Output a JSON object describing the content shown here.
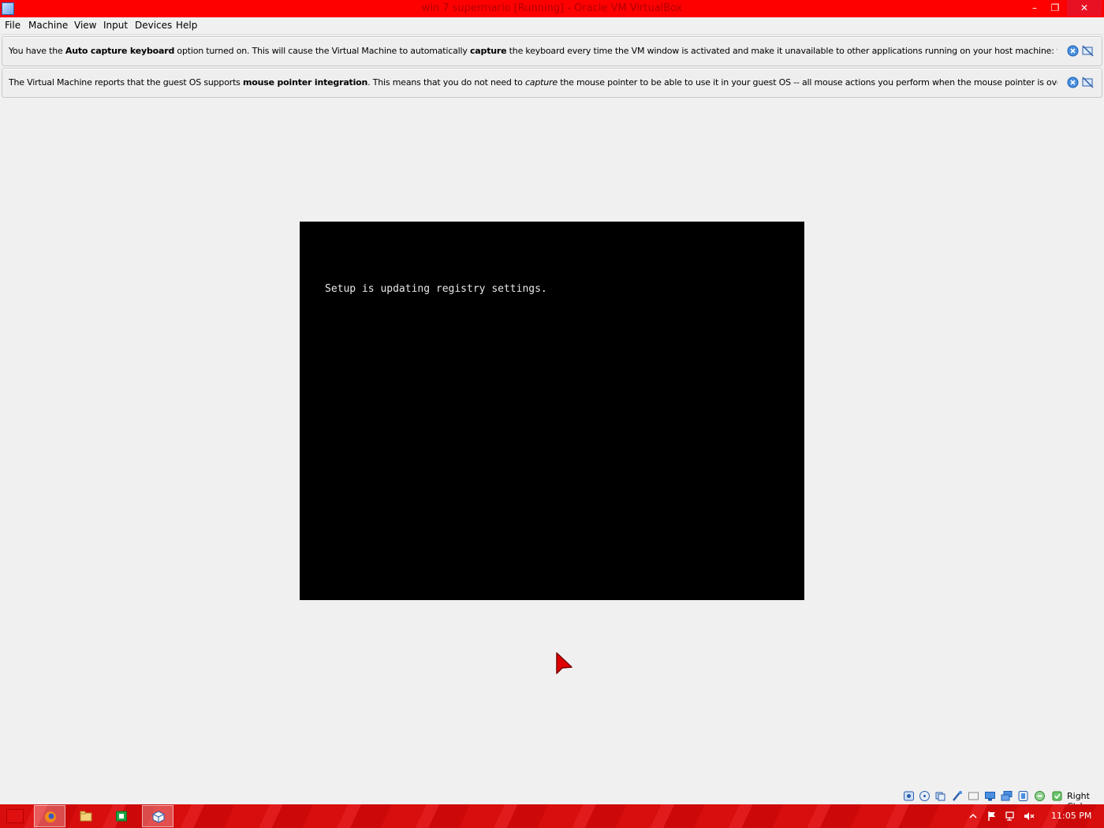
{
  "window": {
    "title": "win 7 supermario [Running] - Oracle VM VirtualBox",
    "minimize_label": "–",
    "restore_label": "❐",
    "close_label": "✕"
  },
  "menu": {
    "file": "File",
    "machine": "Machine",
    "view": "View",
    "input": "Input",
    "devices": "Devices",
    "help": "Help"
  },
  "banners": [
    {
      "t1": "You have the ",
      "b1": "Auto capture keyboard",
      "t2": " option turned on. This will cause the Virtual Machine to automatically ",
      "b2": "capture",
      "t3": " the keyboard every time the VM window is activated and make it unavailable to other applications running on your host machine: when the keyboard is"
    },
    {
      "t1": "The Virtual Machine reports that the guest OS supports ",
      "b1": "mouse pointer integration",
      "t2": ". This means that you do not need to ",
      "i1": "capture",
      "t3": " the mouse pointer to be able to use it in your guest OS -- all mouse actions you perform when the mouse pointer is over the Virtual Machine's"
    }
  ],
  "vm": {
    "console_text": "Setup is updating registry settings."
  },
  "statusbar": {
    "icons": [
      "hard-disk-icon",
      "optical-drive-icon",
      "audio-icon",
      "network-icon",
      "usb-icon",
      "shared-folders-icon",
      "display-icon",
      "video-capture-icon",
      "virtualization-icon",
      "mouse-integration-icon",
      "keyboard-capture-icon"
    ],
    "host_key": "Right Ctrl"
  },
  "taskbar": {
    "apps": [
      "firefox-icon",
      "file-explorer-icon",
      "store-icon",
      "virtualbox-icon"
    ],
    "active_app": "virtualbox-icon",
    "clock": "11:05 PM"
  },
  "colors": {
    "titlebar": "#ff0000",
    "taskbar": "#d80d0d",
    "close_button": "#e81123",
    "vm_screen": "#000000"
  }
}
